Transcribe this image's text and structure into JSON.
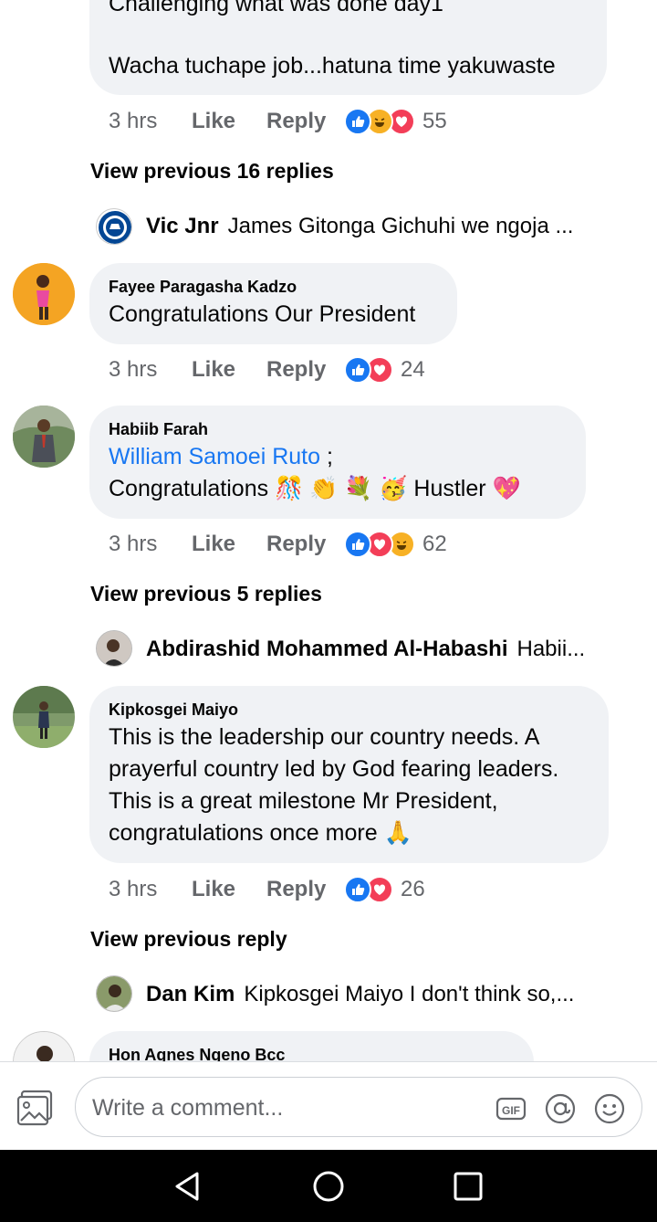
{
  "top_comment": {
    "text_line1": "Challenging what was done day1",
    "text_line2": "Wacha tuchape job...hatuna time yakuwaste",
    "time": "3 hrs",
    "like": "Like",
    "reply": "Reply",
    "react_count": "55"
  },
  "view_prev_1": "View previous 16 replies",
  "reply_preview_1": {
    "name": "Vic Jnr",
    "text": "James Gitonga Gichuhi we ngoja ..."
  },
  "comment_fayee": {
    "author": "Fayee Paragasha Kadzo",
    "text": "Congratulations Our President",
    "time": "3 hrs",
    "like": "Like",
    "reply": "Reply",
    "react_count": "24"
  },
  "comment_habiib": {
    "author": "Habiib Farah",
    "mention": "William Samoei Ruto",
    "mention_suffix": " ;",
    "text_prefix": "Congratulations",
    "emojis": "🎊 👏 💐 🥳",
    "text_suffix": "Hustler",
    "emoji_end": "💖",
    "time": "3 hrs",
    "like": "Like",
    "reply": "Reply",
    "react_count": "62"
  },
  "view_prev_2": "View previous 5 replies",
  "reply_preview_2": {
    "name": "Abdirashid Mohammed Al-Habashi",
    "text": "Habii..."
  },
  "comment_kipkosgei": {
    "author": "Kipkosgei Maiyo",
    "text": "This is the leadership our country needs. A\nprayerful country led by God fearing leaders.\nThis is a great milestone Mr President,\ncongratulations once more 🙏",
    "time": "3 hrs",
    "like": "Like",
    "reply": "Reply",
    "react_count": "26"
  },
  "view_prev_3": "View previous reply",
  "reply_preview_3": {
    "name": "Dan Kim",
    "text": "Kipkosgei Maiyo I don't think so,..."
  },
  "comment_agnes": {
    "author": "Hon Agnes Ngeno Bcc"
  },
  "composer": {
    "placeholder": "Write a comment...",
    "gif_label": "GIF"
  },
  "colors": {
    "accent": "#1877f2",
    "bubble": "#f0f2f5",
    "meta": "#65676b",
    "love": "#f33e58",
    "haha": "#f7b125"
  },
  "icons": [
    "photo-icon",
    "gif-icon",
    "mention-icon",
    "emoji-icon",
    "back-icon",
    "home-icon",
    "recents-icon"
  ]
}
